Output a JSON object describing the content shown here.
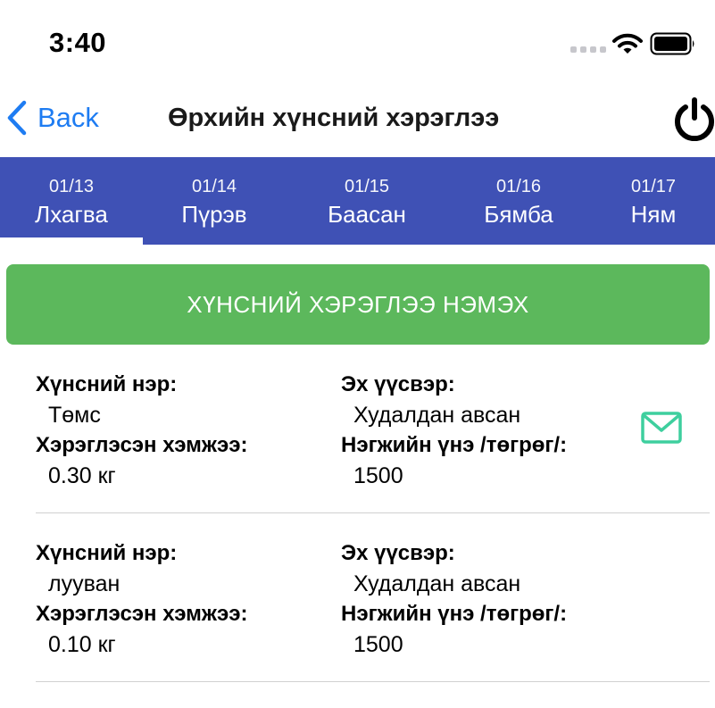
{
  "status_bar": {
    "time": "3:40",
    "icons": [
      "signal-dots-icon",
      "wifi-icon",
      "battery-icon"
    ]
  },
  "nav": {
    "back_label": "Back",
    "title": "Өрхийн хүнсний хэрэглээ",
    "back_icon": "chevron-left-icon",
    "power_icon": "power-icon",
    "accent_color": "#1e7cf2"
  },
  "tabs": {
    "background": "#3f51b5",
    "selected_index": 0,
    "items": [
      {
        "date": "01/13",
        "day": "Лхагва"
      },
      {
        "date": "01/14",
        "day": "Пүрэв"
      },
      {
        "date": "01/15",
        "day": "Баасан"
      },
      {
        "date": "01/16",
        "day": "Бямба"
      },
      {
        "date": "01/17",
        "day": "Ням"
      }
    ]
  },
  "add_button": {
    "label": "ХҮНСНИЙ ХЭРЭГЛЭЭ НЭМЭХ",
    "color": "#5cb85c"
  },
  "labels": {
    "food_name": "Хүнсний нэр:",
    "amount": "Хэрэглэсэн хэмжээ:",
    "source": "Эх үүсвэр:",
    "unit_price": "Нэгжийн үнэ /төгрөг/:"
  },
  "items": [
    {
      "name": "Төмс",
      "amount": "0.30 кг",
      "source": "Худалдан авсан",
      "price": "1500",
      "has_mail_icon": true
    },
    {
      "name": "лууван",
      "amount": "0.10 кг",
      "source": "Худалдан авсан",
      "price": "1500",
      "has_mail_icon": false
    }
  ],
  "mail_icon": {
    "name": "mail-icon",
    "color": "#3ecf9e"
  }
}
